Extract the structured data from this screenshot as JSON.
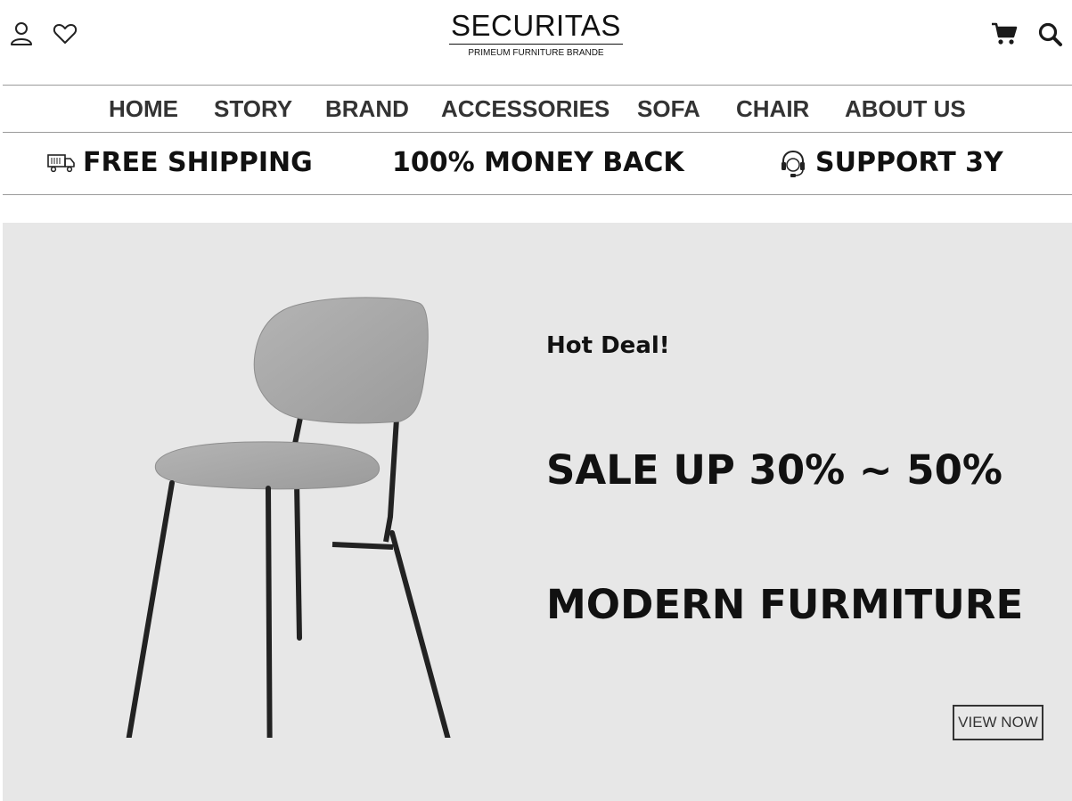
{
  "header": {
    "brand_name": "SECURITAS",
    "brand_tagline": "PRIMEUM FURNITURE BRANDE",
    "icons": {
      "account": "user-icon",
      "wishlist": "heart-icon",
      "cart": "cart-icon",
      "search": "search-icon"
    }
  },
  "nav": {
    "items": [
      {
        "label": "HOME"
      },
      {
        "label": "STORY"
      },
      {
        "label": "BRAND"
      },
      {
        "label": "ACCESSORIES"
      },
      {
        "label": "SOFA"
      },
      {
        "label": "CHAIR"
      },
      {
        "label": "ABOUT US"
      }
    ]
  },
  "features": {
    "items": [
      {
        "label": "FREE SHIPPING",
        "icon": "truck-icon"
      },
      {
        "label": "100% MONEY BACK"
      },
      {
        "label": "SUPPORT 3Y",
        "icon": "headset-icon"
      }
    ]
  },
  "hero": {
    "kicker": "Hot Deal!",
    "headline_1": "SALE UP 30% ~ 50%",
    "headline_2": "MODERN FURMITURE",
    "cta_label": "VIEW NOW",
    "image": "chair-image",
    "background_color": "#e7e7e7"
  }
}
